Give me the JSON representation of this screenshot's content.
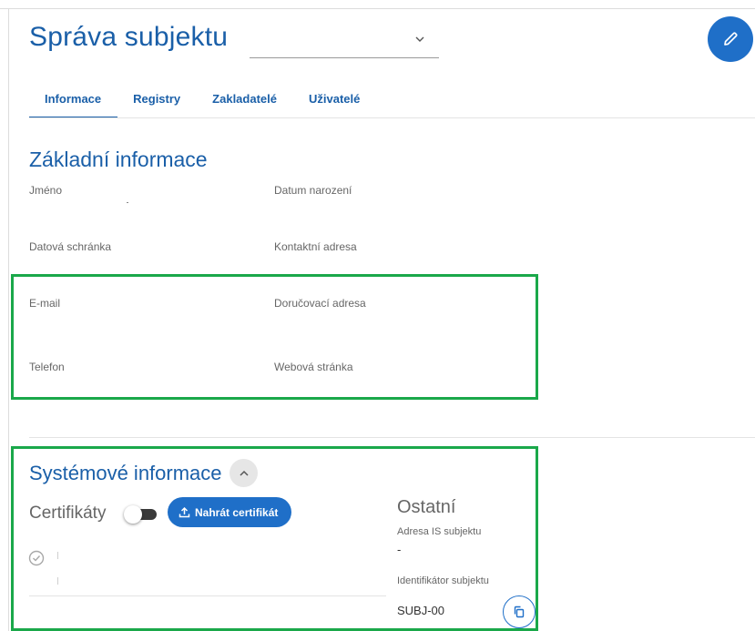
{
  "header": {
    "title": "Správa subjektu",
    "subject_select_value": "",
    "edit_icon": "pencil-icon"
  },
  "tabs": [
    {
      "label": "Informace",
      "active": true
    },
    {
      "label": "Registry",
      "active": false
    },
    {
      "label": "Zakladatelé",
      "active": false
    },
    {
      "label": "Uživatelé",
      "active": false
    }
  ],
  "basic_info": {
    "title": "Základní informace",
    "fields": {
      "name": "Jméno",
      "birth_date": "Datum narození",
      "data_box": "Datová schránka",
      "contact_address": "Kontaktní adresa",
      "email": "E-mail",
      "delivery_address": "Doručovací adresa",
      "phone": "Telefon",
      "website": "Webová stránka"
    }
  },
  "system_info": {
    "title": "Systémové informace",
    "collapse_icon": "chevron-up-icon",
    "certificates_label": "Certifikáty",
    "certificates_toggle_on": false,
    "upload_button": "Nahrát certifikát",
    "other": {
      "title": "Ostatní",
      "is_address_label": "Adresa IS subjektu",
      "is_address_value": "-",
      "subject_id_label": "Identifikátor subjektu",
      "subject_id_value": "SUBJ-00"
    }
  },
  "colors": {
    "primary": "#1f6fc8",
    "title_blue": "#1a5fa8",
    "highlight_green": "#1aa84a"
  }
}
